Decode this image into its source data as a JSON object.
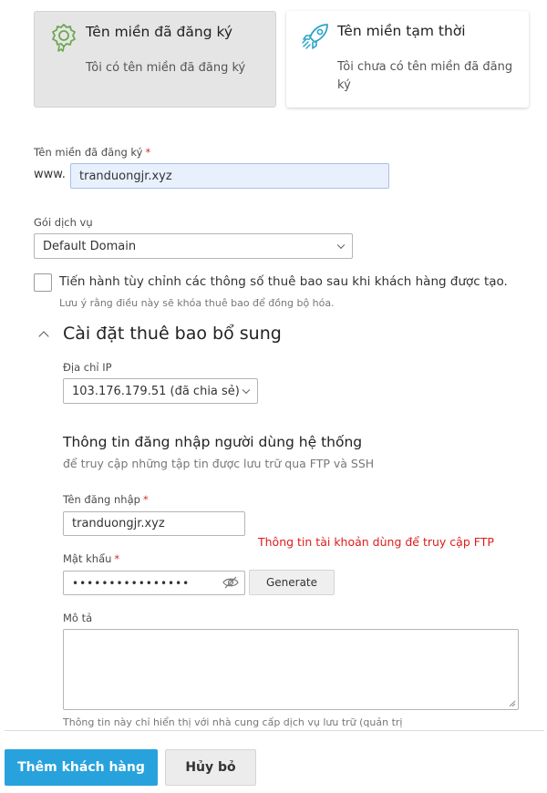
{
  "domain_type_cards": [
    {
      "title": "Tên miền đã đăng ký",
      "description": "Tôi có tên miền đã đăng ký",
      "icon": "award-badge-icon",
      "selected": true
    },
    {
      "title": "Tên miền tạm thời",
      "description": "Tôi chưa có tên miền đã đăng ký",
      "icon": "rocket-icon",
      "selected": false
    }
  ],
  "domain_field": {
    "label": "Tên miền đã đăng ký",
    "required_mark": "*",
    "prefix": "www.",
    "value": "tranduongjr.xyz"
  },
  "plan_field": {
    "label": "Gói dịch vụ",
    "value": "Default Domain"
  },
  "customize_checkbox": {
    "label": "Tiến hành tùy chỉnh các thông số thuê bao sau khi khách hàng được tạo.",
    "hint": "Lưu ý rằng điều này sẽ khóa thuê bao để đồng bộ hóa.",
    "checked": false
  },
  "additional_settings": {
    "title": "Cài đặt thuê bao bổ sung",
    "ip_field": {
      "label": "Địa chỉ IP",
      "value": "103.176.179.51 (đã chia sẻ)"
    },
    "login_section": {
      "title": "Thông tin đăng nhập người dùng hệ thống",
      "subtitle": "để truy cập những tập tin được lưu trữ qua FTP và SSH"
    },
    "username_field": {
      "label": "Tên đăng nhập",
      "required_mark": "*",
      "value": "tranduongjr.xyz"
    },
    "password_field": {
      "label": "Mật khẩu",
      "required_mark": "*",
      "value": "••••••••••••••••",
      "generate_label": "Generate"
    },
    "annotation": "Thông tin tài khoản dùng để truy cập FTP",
    "description_field": {
      "label": "Mô tả",
      "value": "",
      "hint": "Thông tin này chỉ hiển thị với nhà cung cấp dịch vụ lưu trữ (quản trị"
    }
  },
  "actions": {
    "add_customer": "Thêm khách hàng",
    "cancel": "Hủy bỏ"
  },
  "colors": {
    "primary": "#27a2dd",
    "required": "#d02d2d",
    "annotation": "#e01b1b",
    "icon_green": "#6aa84f",
    "icon_teal": "#2fa4c7"
  }
}
